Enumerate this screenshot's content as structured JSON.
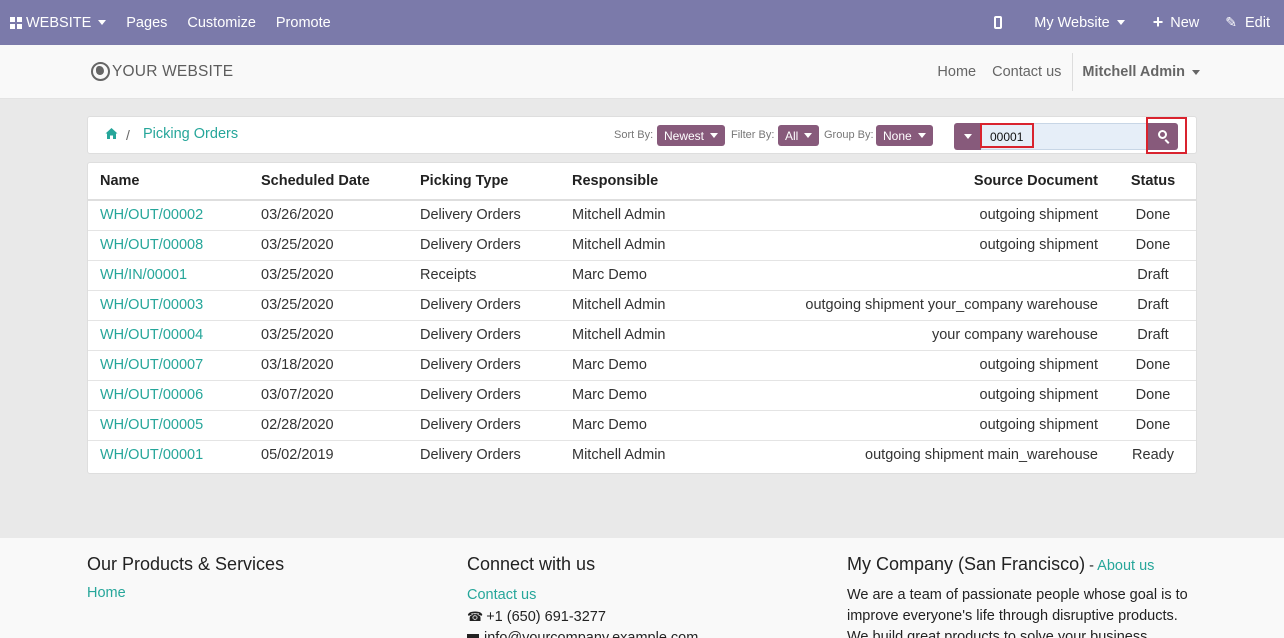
{
  "topbar": {
    "website_label": "WEBSITE",
    "menu": [
      "Pages",
      "Customize",
      "Promote"
    ],
    "site_selector": "My Website",
    "new_label": "New",
    "edit_label": "Edit"
  },
  "header": {
    "logo_text": "YOUR WEBSITE",
    "nav": [
      "Home",
      "Contact us"
    ],
    "user": "Mitchell Admin"
  },
  "breadcrumb": {
    "active": "Picking Orders"
  },
  "controls": {
    "sort_label": "Sort By:",
    "sort_value": "Newest",
    "filter_label": "Filter By:",
    "filter_value": "All",
    "group_label": "Group By:",
    "group_value": "None",
    "search_value": "00001"
  },
  "table": {
    "columns": [
      "Name",
      "Scheduled Date",
      "Picking Type",
      "Responsible",
      "Source Document",
      "Status"
    ],
    "rows": [
      {
        "name": "WH/OUT/00002",
        "date": "03/26/2020",
        "type": "Delivery Orders",
        "responsible": "Mitchell Admin",
        "source": "outgoing shipment",
        "status": "Done"
      },
      {
        "name": "WH/OUT/00008",
        "date": "03/25/2020",
        "type": "Delivery Orders",
        "responsible": "Mitchell Admin",
        "source": "outgoing shipment",
        "status": "Done"
      },
      {
        "name": "WH/IN/00001",
        "date": "03/25/2020",
        "type": "Receipts",
        "responsible": "Marc Demo",
        "source": "",
        "status": "Draft"
      },
      {
        "name": "WH/OUT/00003",
        "date": "03/25/2020",
        "type": "Delivery Orders",
        "responsible": "Mitchell Admin",
        "source": "outgoing shipment your_company warehouse",
        "status": "Draft"
      },
      {
        "name": "WH/OUT/00004",
        "date": "03/25/2020",
        "type": "Delivery Orders",
        "responsible": "Mitchell Admin",
        "source": "your company warehouse",
        "status": "Draft"
      },
      {
        "name": "WH/OUT/00007",
        "date": "03/18/2020",
        "type": "Delivery Orders",
        "responsible": "Marc Demo",
        "source": "outgoing shipment",
        "status": "Done"
      },
      {
        "name": "WH/OUT/00006",
        "date": "03/07/2020",
        "type": "Delivery Orders",
        "responsible": "Marc Demo",
        "source": "outgoing shipment",
        "status": "Done"
      },
      {
        "name": "WH/OUT/00005",
        "date": "02/28/2020",
        "type": "Delivery Orders",
        "responsible": "Marc Demo",
        "source": "outgoing shipment",
        "status": "Done"
      },
      {
        "name": "WH/OUT/00001",
        "date": "05/02/2019",
        "type": "Delivery Orders",
        "responsible": "Mitchell Admin",
        "source": "outgoing shipment main_warehouse",
        "status": "Ready"
      }
    ]
  },
  "footer": {
    "col1_title": "Our Products & Services",
    "col1_link": "Home",
    "col2_title": "Connect with us",
    "col2_link": "Contact us",
    "phone": "+1 (650) 691-3277",
    "email": "info@yourcompany.example.com",
    "col3_title": "My Company (San Francisco)",
    "col3_sep": " - ",
    "col3_link": "About us",
    "col3_text": "We are a team of passionate people whose goal is to improve everyone's life through disruptive products. We build great products to solve your business problems."
  },
  "colors": {
    "topbar_bg": "#7b7aaa",
    "accent_link": "#26a69a",
    "button_bg": "#875a7b",
    "highlight_border": "#d9232e"
  }
}
